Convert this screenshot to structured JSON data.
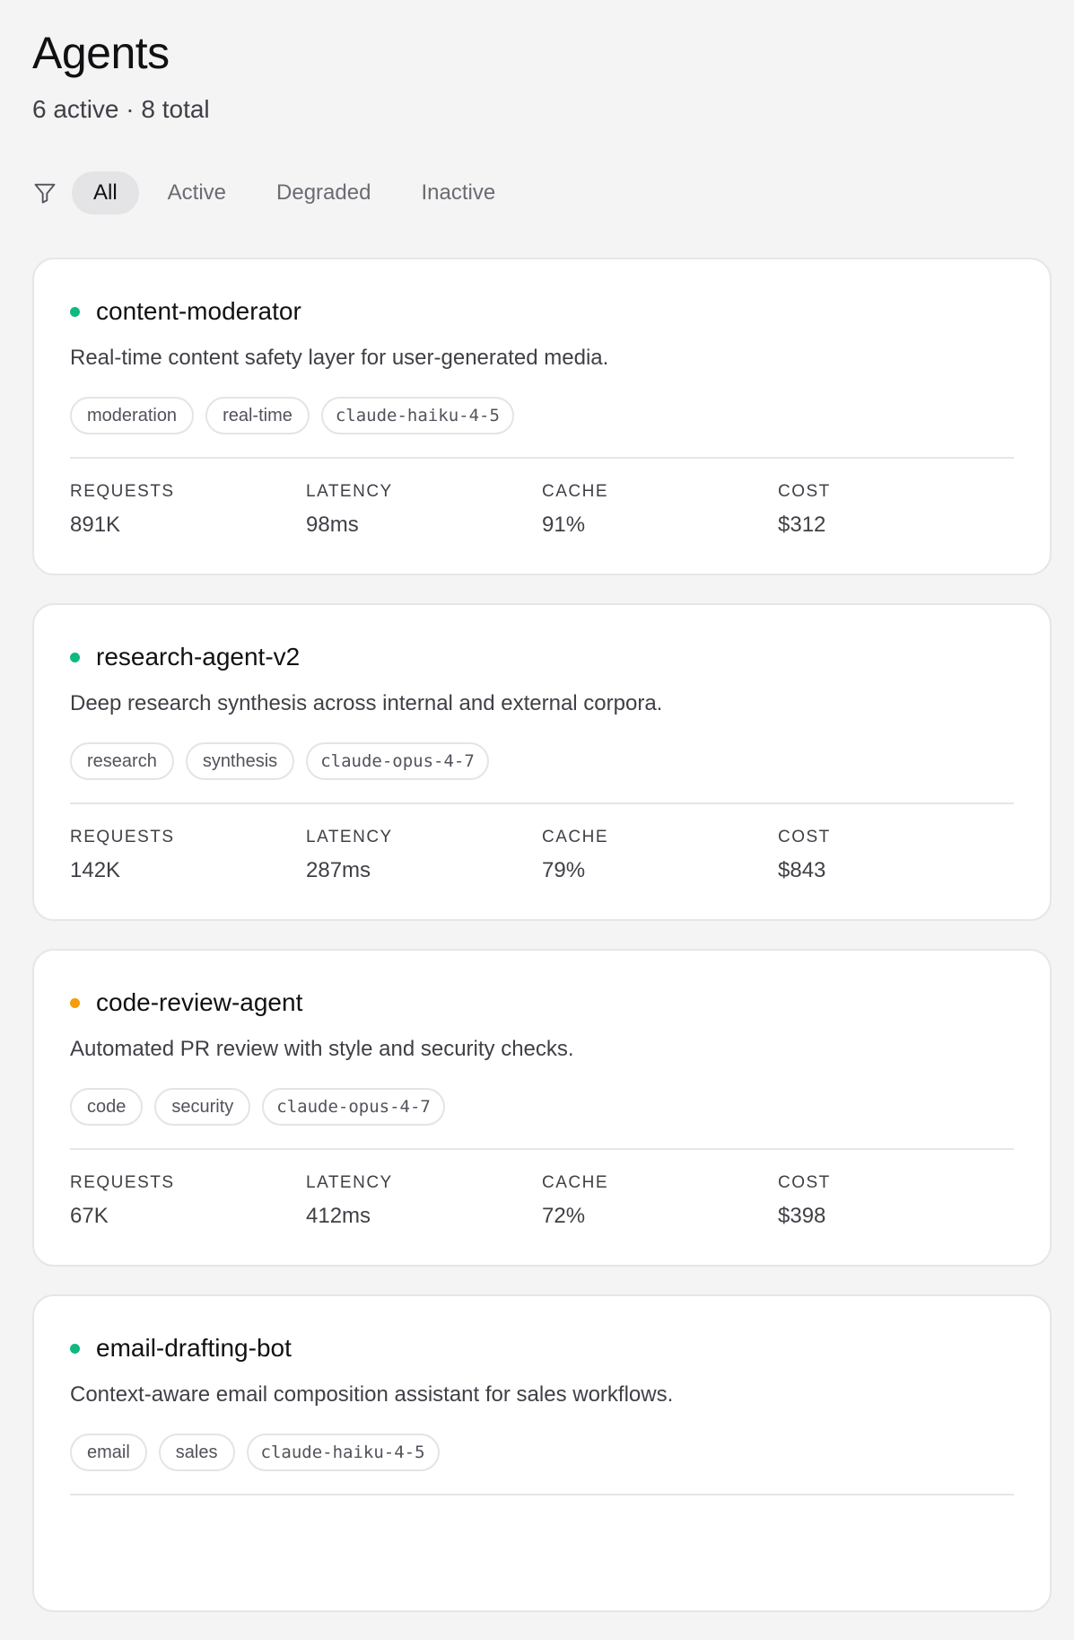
{
  "header": {
    "title": "Agents",
    "subtitle": "6 active · 8 total"
  },
  "filters": {
    "icon": "filter-icon",
    "tabs": [
      {
        "label": "All",
        "selected": true
      },
      {
        "label": "Active",
        "selected": false
      },
      {
        "label": "Degraded",
        "selected": false
      },
      {
        "label": "Inactive",
        "selected": false
      }
    ]
  },
  "metric_labels": {
    "requests": "REQUESTS",
    "latency": "LATENCY",
    "cache": "CACHE",
    "cost": "COST"
  },
  "status_colors": {
    "active": "#10b981",
    "degraded": "#f59e0b"
  },
  "agents": [
    {
      "name": "content-moderator",
      "status": "active",
      "description": "Real-time content safety layer for user-generated media.",
      "tags": [
        "moderation",
        "real-time"
      ],
      "model": "claude-haiku-4-5",
      "metrics": {
        "requests": "891K",
        "latency": "98ms",
        "cache": "91%",
        "cost": "$312"
      }
    },
    {
      "name": "research-agent-v2",
      "status": "active",
      "description": "Deep research synthesis across internal and external corpora.",
      "tags": [
        "research",
        "synthesis"
      ],
      "model": "claude-opus-4-7",
      "metrics": {
        "requests": "142K",
        "latency": "287ms",
        "cache": "79%",
        "cost": "$843"
      }
    },
    {
      "name": "code-review-agent",
      "status": "degraded",
      "description": "Automated PR review with style and security checks.",
      "tags": [
        "code",
        "security"
      ],
      "model": "claude-opus-4-7",
      "metrics": {
        "requests": "67K",
        "latency": "412ms",
        "cache": "72%",
        "cost": "$398"
      }
    },
    {
      "name": "email-drafting-bot",
      "status": "active",
      "description": "Context-aware email composition assistant for sales workflows.",
      "tags": [
        "email",
        "sales"
      ],
      "model": "claude-haiku-4-5",
      "metrics": {
        "requests": "",
        "latency": "",
        "cache": "",
        "cost": ""
      }
    }
  ]
}
